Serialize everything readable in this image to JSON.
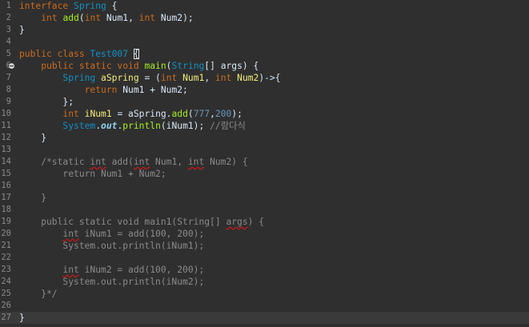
{
  "lines": [
    {
      "no": "1",
      "tokens": [
        {
          "t": "interface ",
          "c": "kw"
        },
        {
          "t": "Spring",
          "c": "type"
        },
        {
          "t": " {",
          "c": "plain"
        }
      ]
    },
    {
      "no": "2",
      "tokens": [
        {
          "t": "    ",
          "c": "plain"
        },
        {
          "t": "int",
          "c": "kw"
        },
        {
          "t": " ",
          "c": "plain"
        },
        {
          "t": "add",
          "c": "method"
        },
        {
          "t": "(",
          "c": "plain"
        },
        {
          "t": "int",
          "c": "kw"
        },
        {
          "t": " Num1, ",
          "c": "plain"
        },
        {
          "t": "int",
          "c": "kw"
        },
        {
          "t": " Num2);",
          "c": "plain"
        }
      ]
    },
    {
      "no": "3",
      "tokens": [
        {
          "t": "}",
          "c": "plain"
        }
      ]
    },
    {
      "no": "4",
      "tokens": []
    },
    {
      "no": "5",
      "tokens": [
        {
          "t": "public class ",
          "c": "kw"
        },
        {
          "t": "Test007",
          "c": "type"
        },
        {
          "t": " ",
          "c": "plain"
        },
        {
          "t": "{",
          "c": "plain",
          "box": true
        }
      ]
    },
    {
      "no": "6",
      "fold": true,
      "tokens": [
        {
          "t": "    ",
          "c": "plain"
        },
        {
          "t": "public static void ",
          "c": "kw"
        },
        {
          "t": "main",
          "c": "method"
        },
        {
          "t": "(",
          "c": "plain"
        },
        {
          "t": "String",
          "c": "type"
        },
        {
          "t": "[] args) {",
          "c": "plain"
        }
      ]
    },
    {
      "no": "7",
      "tokens": [
        {
          "t": "        ",
          "c": "plain"
        },
        {
          "t": "Spring",
          "c": "type"
        },
        {
          "t": " ",
          "c": "plain"
        },
        {
          "t": "aSpring",
          "c": "var"
        },
        {
          "t": " = (",
          "c": "plain"
        },
        {
          "t": "int",
          "c": "kw"
        },
        {
          "t": " ",
          "c": "plain"
        },
        {
          "t": "Num1",
          "c": "var"
        },
        {
          "t": ", ",
          "c": "plain"
        },
        {
          "t": "int",
          "c": "kw"
        },
        {
          "t": " ",
          "c": "plain"
        },
        {
          "t": "Num2",
          "c": "var"
        },
        {
          "t": ")->{",
          "c": "plain"
        }
      ]
    },
    {
      "no": "8",
      "tokens": [
        {
          "t": "            ",
          "c": "plain"
        },
        {
          "t": "return",
          "c": "kw"
        },
        {
          "t": " Num1 + Num2;",
          "c": "plain"
        }
      ]
    },
    {
      "no": "9",
      "tokens": [
        {
          "t": "        };",
          "c": "plain"
        }
      ]
    },
    {
      "no": "10",
      "tokens": [
        {
          "t": "        ",
          "c": "plain"
        },
        {
          "t": "int",
          "c": "kw"
        },
        {
          "t": " ",
          "c": "plain"
        },
        {
          "t": "iNum1",
          "c": "var"
        },
        {
          "t": " = aSpring.",
          "c": "plain"
        },
        {
          "t": "add",
          "c": "method"
        },
        {
          "t": "(",
          "c": "plain"
        },
        {
          "t": "777",
          "c": "num"
        },
        {
          "t": ",",
          "c": "plain"
        },
        {
          "t": "200",
          "c": "num"
        },
        {
          "t": ");",
          "c": "plain"
        }
      ]
    },
    {
      "no": "11",
      "tokens": [
        {
          "t": "        ",
          "c": "plain"
        },
        {
          "t": "System",
          "c": "type"
        },
        {
          "t": ".",
          "c": "plain"
        },
        {
          "t": "out",
          "c": "field"
        },
        {
          "t": ".",
          "c": "plain"
        },
        {
          "t": "println",
          "c": "method"
        },
        {
          "t": "(iNum1); ",
          "c": "plain"
        },
        {
          "t": "//람다식",
          "c": "cmt"
        }
      ]
    },
    {
      "no": "12",
      "tokens": [
        {
          "t": "    }",
          "c": "plain"
        }
      ]
    },
    {
      "no": "13",
      "tokens": []
    },
    {
      "no": "14",
      "tokens": [
        {
          "t": "    /*static ",
          "c": "cmt"
        },
        {
          "t": "int",
          "c": "cmt",
          "sq": true
        },
        {
          "t": " add(",
          "c": "cmt"
        },
        {
          "t": "int",
          "c": "cmt",
          "sq": true
        },
        {
          "t": " Num1, ",
          "c": "cmt"
        },
        {
          "t": "int",
          "c": "cmt",
          "sq": true
        },
        {
          "t": " Num2) {",
          "c": "cmt"
        }
      ]
    },
    {
      "no": "15",
      "tokens": [
        {
          "t": "        return Num1 + Num2;",
          "c": "cmt"
        }
      ]
    },
    {
      "no": "16",
      "tokens": []
    },
    {
      "no": "17",
      "tokens": [
        {
          "t": "    }",
          "c": "cmt"
        }
      ]
    },
    {
      "no": "18",
      "tokens": []
    },
    {
      "no": "19",
      "tokens": [
        {
          "t": "    public static void main1(String[] ",
          "c": "cmt"
        },
        {
          "t": "args",
          "c": "cmt",
          "sq": true
        },
        {
          "t": ") {",
          "c": "cmt"
        }
      ]
    },
    {
      "no": "20",
      "tokens": [
        {
          "t": "        ",
          "c": "cmt"
        },
        {
          "t": "int",
          "c": "cmt",
          "sq": true
        },
        {
          "t": " iNum1 = add(100, 200);",
          "c": "cmt"
        }
      ]
    },
    {
      "no": "21",
      "tokens": [
        {
          "t": "        System.out.println(iNum1);",
          "c": "cmt"
        }
      ]
    },
    {
      "no": "22",
      "tokens": []
    },
    {
      "no": "23",
      "tokens": [
        {
          "t": "        ",
          "c": "cmt"
        },
        {
          "t": "int",
          "c": "cmt",
          "sq": true
        },
        {
          "t": " iNum2 = add(100, 200);",
          "c": "cmt"
        }
      ]
    },
    {
      "no": "24",
      "tokens": [
        {
          "t": "        System.out.println(iNum2);",
          "c": "cmt"
        }
      ]
    },
    {
      "no": "25",
      "tokens": [
        {
          "t": "    }*/",
          "c": "cmt"
        }
      ]
    },
    {
      "no": "26",
      "tokens": []
    },
    {
      "no": "27",
      "current": true,
      "tokens": [
        {
          "t": "}",
          "c": "plain"
        }
      ]
    }
  ]
}
